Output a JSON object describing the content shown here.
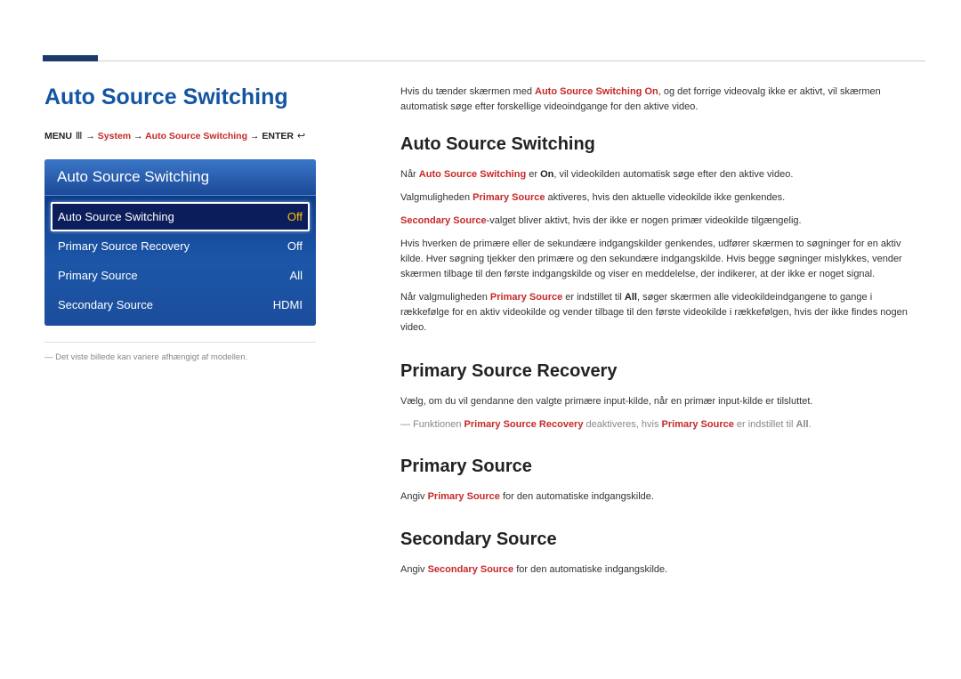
{
  "page_title": "Auto Source Switching",
  "breadcrumb": {
    "menu": "MENU",
    "system": "System",
    "page": "Auto Source Switching",
    "enter": "ENTER"
  },
  "menu": {
    "header": "Auto Source Switching",
    "rows": [
      {
        "label": "Auto Source Switching",
        "value": "Off",
        "selected": true
      },
      {
        "label": "Primary Source Recovery",
        "value": "Off",
        "selected": false
      },
      {
        "label": "Primary Source",
        "value": "All",
        "selected": false
      },
      {
        "label": "Secondary Source",
        "value": "HDMI",
        "selected": false
      }
    ]
  },
  "left_note": "Det viste billede kan variere afhængigt af modellen.",
  "intro": {
    "p1_a": "Hvis du tænder skærmen med ",
    "p1_b": "Auto Source Switching On",
    "p1_c": ", og det forrige videovalg ikke er aktivt, vil skærmen automatisk søge efter forskellige videoindgange for den aktive video."
  },
  "sec_ass": {
    "heading": "Auto Source Switching",
    "p1_a": "Når ",
    "p1_b": "Auto Source Switching",
    "p1_c": " er ",
    "p1_d": "On",
    "p1_e": ", vil videokilden automatisk søge efter den aktive video.",
    "p2_a": "Valgmuligheden ",
    "p2_b": "Primary Source",
    "p2_c": " aktiveres, hvis den aktuelle videokilde ikke genkendes.",
    "p3_a": "Secondary Source",
    "p3_b": "-valget bliver aktivt, hvis der ikke er nogen primær videokilde tilgængelig.",
    "p4": "Hvis hverken de primære eller de sekundære indgangskilder genkendes, udfører skærmen to søgninger for en aktiv kilde. Hver søgning tjekker den primære og den sekundære indgangskilde. Hvis begge søgninger mislykkes, vender skærmen tilbage til den første indgangskilde og viser en meddelelse, der indikerer, at der ikke er noget signal.",
    "p5_a": "Når valgmuligheden ",
    "p5_b": "Primary Source",
    "p5_c": " er indstillet til ",
    "p5_d": "All",
    "p5_e": ", søger skærmen alle videokildeindgangene to gange i rækkefølge for en aktiv videokilde og vender tilbage til den første videokilde i rækkefølgen, hvis der ikke findes nogen video."
  },
  "sec_psr": {
    "heading": "Primary Source Recovery",
    "p1": "Vælg, om du vil gendanne den valgte primære input-kilde, når en primær input-kilde er tilsluttet.",
    "note_a": "Funktionen ",
    "note_b": "Primary Source Recovery",
    "note_c": " deaktiveres, hvis ",
    "note_d": "Primary Source",
    "note_e": " er indstillet til ",
    "note_f": "All",
    "note_g": "."
  },
  "sec_ps": {
    "heading": "Primary Source",
    "p_a": "Angiv ",
    "p_b": "Primary Source",
    "p_c": " for den automatiske indgangskilde."
  },
  "sec_ss": {
    "heading": "Secondary Source",
    "p_a": "Angiv ",
    "p_b": "Secondary Source",
    "p_c": " for den automatiske indgangskilde."
  }
}
